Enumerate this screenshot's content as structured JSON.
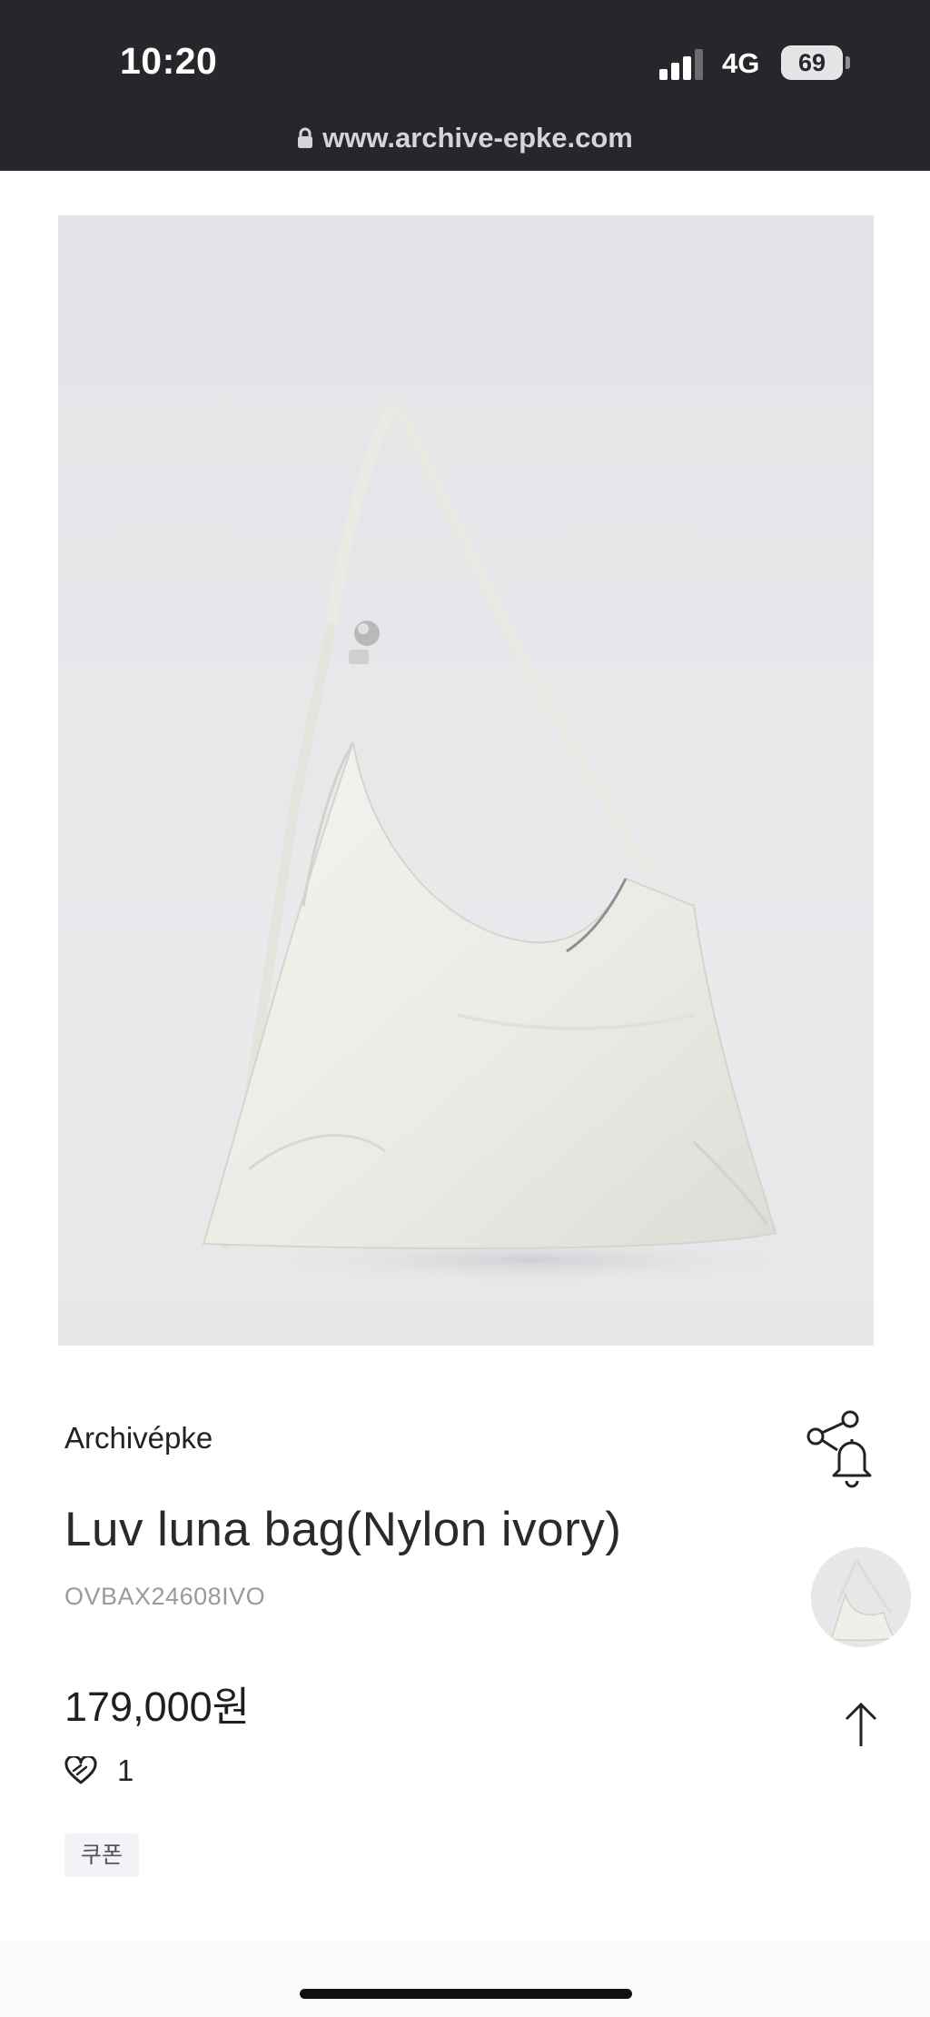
{
  "status_bar": {
    "time": "10:20",
    "network": "4G",
    "battery": "69",
    "signal_icon": "cellular-signal-icon"
  },
  "browser": {
    "url": "www.archive-epke.com",
    "lock_icon": "lock-icon"
  },
  "product": {
    "image_icon": "product-photo-ivory-shoulder-bag",
    "brand": "Archivépke",
    "name": "Luv luna bag(Nylon ivory)",
    "sku": "OVBAX24608IVO",
    "price": "179,000원",
    "like_count": "1",
    "coupon_label": "쿠폰"
  },
  "side_actions": {
    "share_icon": "share-bell-icon",
    "thumbnail_icon": "product-thumbnail",
    "scroll_top_icon": "arrow-up-icon"
  },
  "colors": {
    "status_bar_bg": "#25272b",
    "photo_bg": "#e8e9eb",
    "bag_ivory": "#efeee9",
    "sku_gray": "#9a9a9a",
    "coupon_bg": "#f1f3f6"
  }
}
